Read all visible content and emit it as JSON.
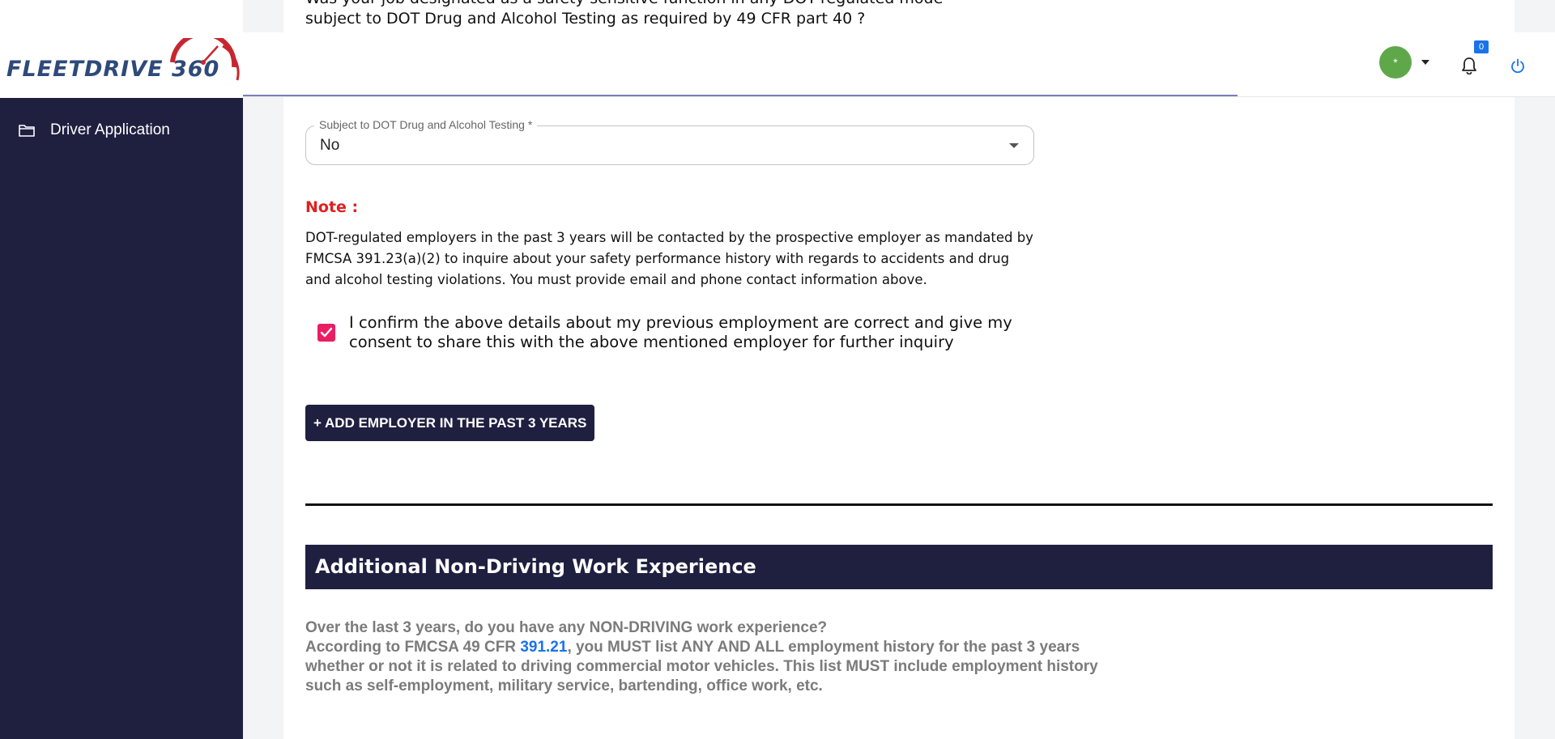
{
  "brand": {
    "logo_text": "FLEETDRIVE 360"
  },
  "sidebar": {
    "items": [
      {
        "label": "Driver Application",
        "icon": "folder-icon"
      }
    ]
  },
  "topbar": {
    "avatar_symbol": "*",
    "notification_count": "0"
  },
  "form": {
    "question_line1": "Was your job designated as a safety-sensitive function in any DOT-regulated mode",
    "question_line2": "subject to DOT Drug and Alcohol Testing as required by 49 CFR part 40 ?",
    "dot_field_label": "Subject to DOT Drug and Alcohol Testing *",
    "dot_field_value": "No",
    "note_title": "Note :",
    "note_body": "DOT-regulated employers in the past 3 years will be contacted by the prospective employer as mandated by FMCSA 391.23(a)(2) to inquire about your safety performance history with regards to accidents and drug and alcohol testing violations. You must provide email and phone contact information above.",
    "confirm_text": "I confirm the above details about my previous employment are correct and give my consent to share this with the above mentioned employer for further inquiry",
    "confirm_checked": true,
    "add_employer_label": "+ ADD EMPLOYER IN THE PAST 3 YEARS"
  },
  "non_driving": {
    "section_title": "Additional Non-Driving Work Experience",
    "question": "Over the last 3 years, do you have any NON-DRIVING work experience?",
    "info_prefix": "According to FMCSA 49 CFR ",
    "info_link": "391.21",
    "info_suffix": ", you MUST list ANY AND ALL employment history for the past 3 years whether or not it is related to driving commercial motor vehicles. This list MUST include employment history such as self-employment, military service, bartending, office work, etc."
  },
  "colors": {
    "sidebar_bg": "#1f2040",
    "note_red": "#e01f1f",
    "checkbox_pink": "#e91e63",
    "link_blue": "#1a73e8",
    "avatar_green": "#5fa84a"
  }
}
